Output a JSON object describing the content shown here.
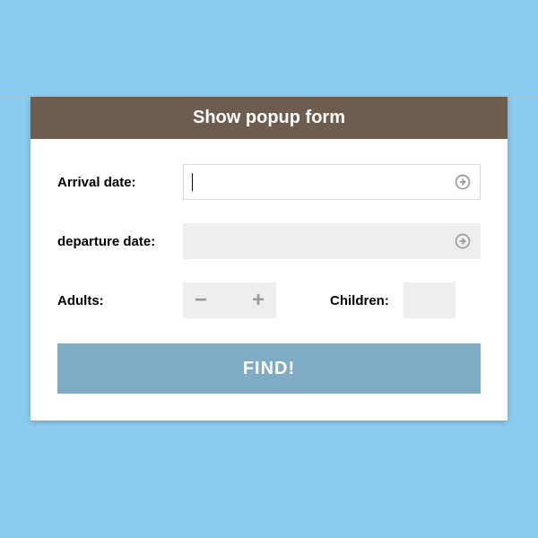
{
  "header": {
    "title": "Show popup form"
  },
  "form": {
    "arrival_label": "Arrival date:",
    "arrival_value": "",
    "departure_label": "departure date:",
    "departure_value": "",
    "adults_label": "Adults:",
    "adults_value": "",
    "children_label": "Children:",
    "children_value": "",
    "submit_label": "FIND!"
  },
  "icons": {
    "minus": "−",
    "plus": "+"
  }
}
